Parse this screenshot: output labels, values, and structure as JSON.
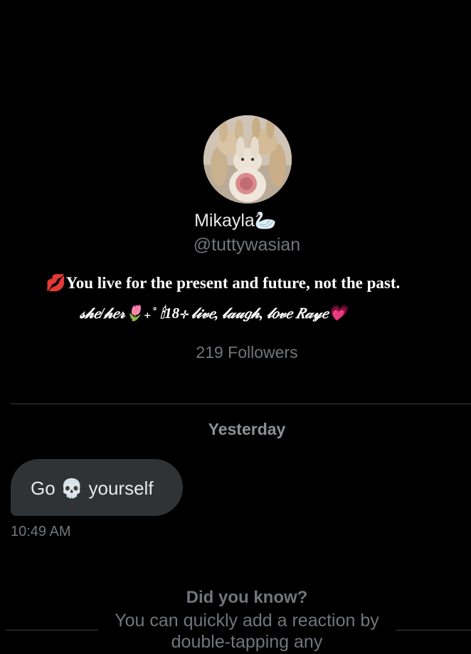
{
  "profile": {
    "avatar_alt": "stuffed bunnies avatar",
    "name": "Mikayla🦢",
    "handle": "@tuttywasian",
    "bio_line1": "💋You live for the present and future, not the past.",
    "bio_line2": "𝓈𝒽𝑒/𝒽𝑒𝓇🌷₊˚ 🕯18⊹ 𝓁𝒾𝓋𝑒, 𝓁𝒶𝓊𝑔𝒽, 𝓁𝑜𝓋𝑒 𝑅𝒶𝓎𝑒💗",
    "followers": "219 Followers"
  },
  "conversation": {
    "date_separator": "Yesterday",
    "messages": [
      {
        "text": "Go 💀 yourself",
        "time": "10:49 AM"
      }
    ]
  },
  "tip": {
    "title": "Did you know?",
    "body": "You can quickly add a reaction by double-tapping any"
  },
  "colors": {
    "background": "#000000",
    "bubble": "#2f3336",
    "muted_text": "#71767b",
    "primary_text": "#e7e9ea"
  }
}
